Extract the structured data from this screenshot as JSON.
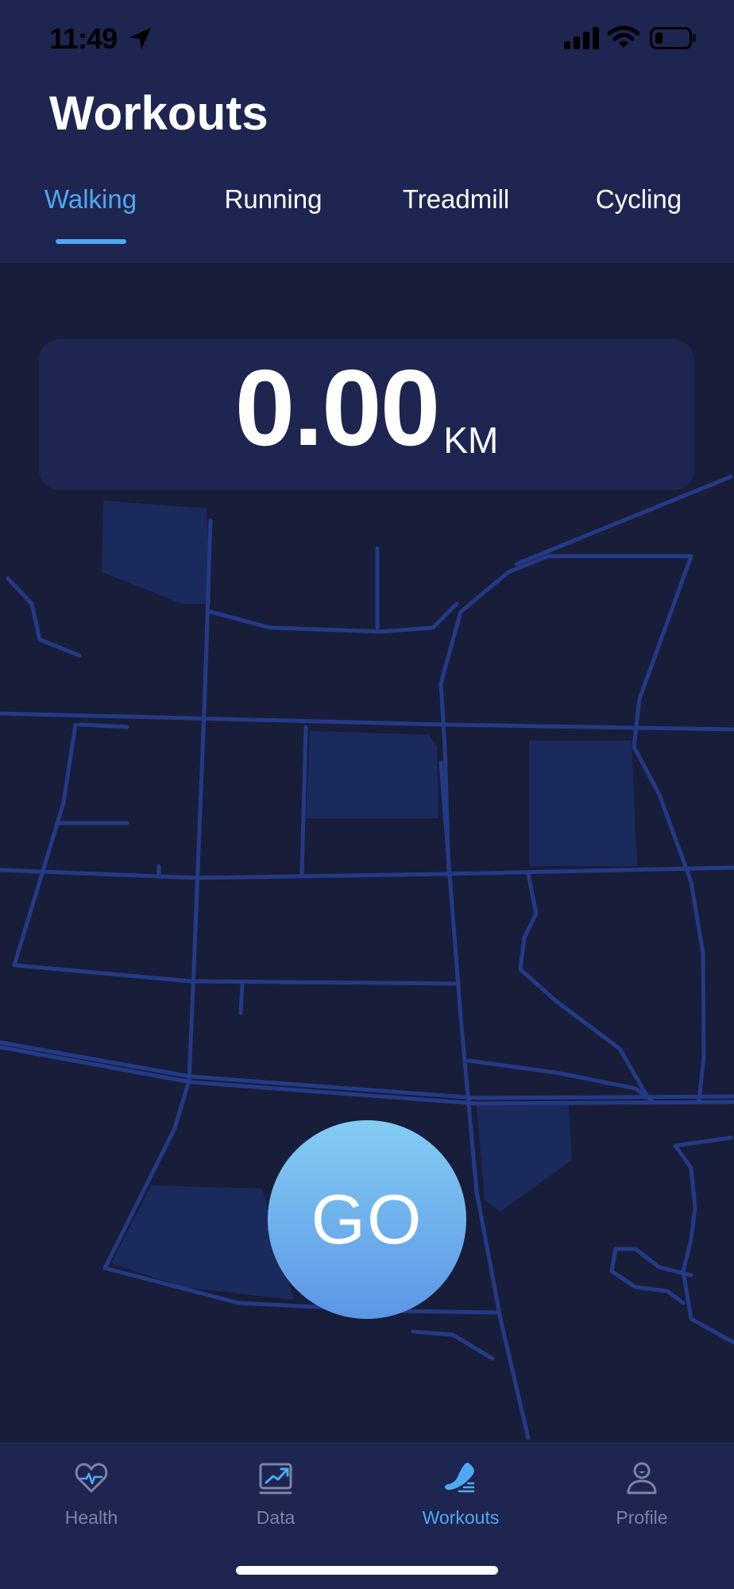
{
  "status_bar": {
    "time": "11:49",
    "icons": [
      "location-arrow-icon",
      "cellular-signal-icon",
      "wifi-icon",
      "battery-icon"
    ]
  },
  "header": {
    "title": "Workouts"
  },
  "tabs": [
    {
      "label": "Walking",
      "active": true
    },
    {
      "label": "Running",
      "active": false
    },
    {
      "label": "Treadmill",
      "active": false
    },
    {
      "label": "Cycling",
      "active": false
    }
  ],
  "distance": {
    "value": "0.00",
    "unit": "KM"
  },
  "go_button": {
    "label": "GO"
  },
  "bottom_nav": [
    {
      "label": "Health",
      "icon": "heart-pulse-icon",
      "active": false
    },
    {
      "label": "Data",
      "icon": "chart-icon",
      "active": false
    },
    {
      "label": "Workouts",
      "icon": "shoe-icon",
      "active": true
    },
    {
      "label": "Profile",
      "icon": "person-icon",
      "active": false
    }
  ],
  "colors": {
    "accent": "#4fa9f0",
    "header_bg": "#1e2550",
    "map_bg": "#181d39",
    "road": "#243a86",
    "inactive_text": "#7c83a6"
  }
}
